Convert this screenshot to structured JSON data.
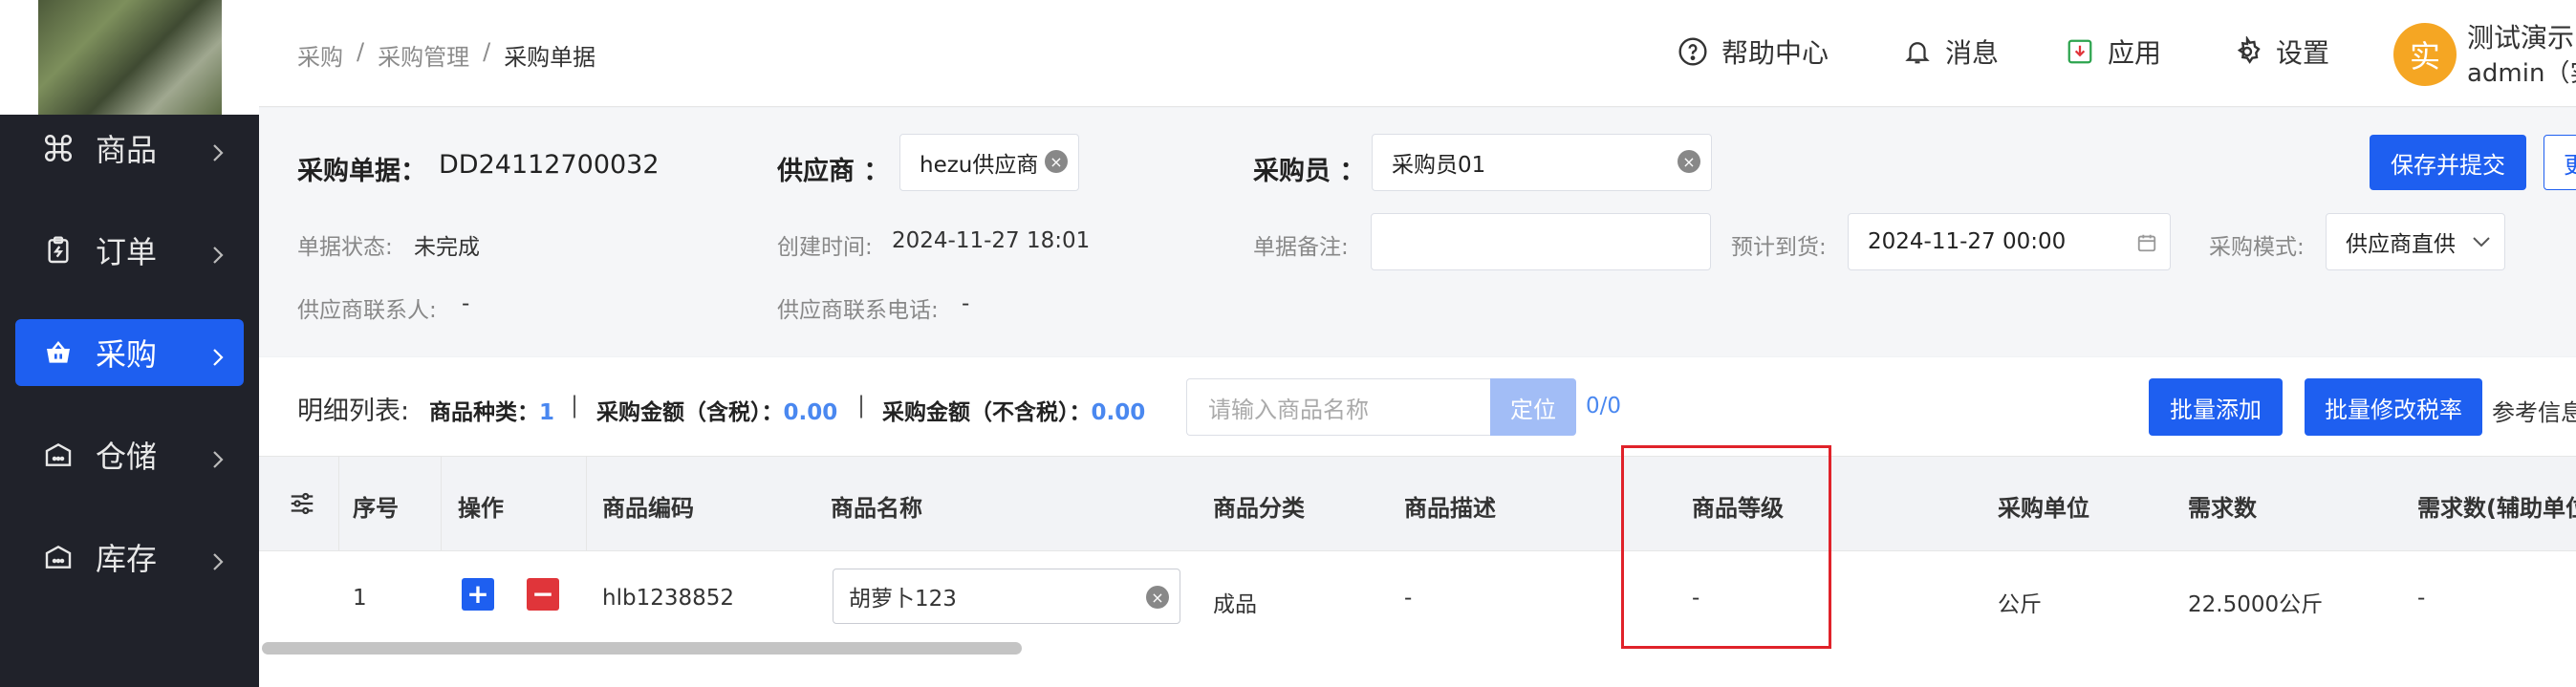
{
  "sidebar": {
    "items": [
      {
        "label": "商品",
        "icon": "command-icon"
      },
      {
        "label": "订单",
        "icon": "clipboard-icon"
      },
      {
        "label": "采购",
        "icon": "basket-icon",
        "active": true
      },
      {
        "label": "仓储",
        "icon": "warehouse-icon"
      },
      {
        "label": "库存",
        "icon": "warehouse-icon"
      }
    ]
  },
  "header": {
    "breadcrumb": [
      "采购",
      "/",
      "采购管理",
      "/",
      "采购单据"
    ],
    "help": "帮助中心",
    "messages": "消息",
    "apps": "应用",
    "settings": "设置",
    "avatar_char": "实",
    "user_name": "测试演示",
    "user_role": "admin（实"
  },
  "form": {
    "order_label": "采购单据：",
    "order_no": "DD24112700032",
    "supplier_label": "供应商 ：",
    "supplier_value": "hezu供应商",
    "buyer_label": "采购员 ：",
    "buyer_value": "采购员01",
    "save_submit": "保存并提交",
    "more_btn": "更",
    "status_label": "单据状态:",
    "status_value": "未完成",
    "created_label": "创建时间:",
    "created_value": "2024-11-27 18:01",
    "remark_label": "单据备注:",
    "remark_value": "",
    "eta_label": "预计到货:",
    "eta_value": "2024-11-27 00:00",
    "mode_label": "采购模式:",
    "mode_value": "供应商直供",
    "contact_label": "供应商联系人:",
    "contact_value": "-",
    "phone_label": "供应商联系电话:",
    "phone_value": "-"
  },
  "detail": {
    "title": "明细列表:",
    "kinds_label": "商品种类：",
    "kinds_value": "1",
    "amount_tax_label": "采购金额（含税）：",
    "amount_tax_value": "0.00",
    "amount_notax_label": "采购金额（不含税）：",
    "amount_notax_value": "0.00",
    "search_placeholder": "请输入商品名称",
    "locate_btn": "定位",
    "count": "0/0",
    "batch_add": "批量添加",
    "batch_tax": "批量修改税率",
    "ref_info": "参考信息"
  },
  "table": {
    "headers": [
      "序号",
      "操作",
      "商品编码",
      "商品名称",
      "商品分类",
      "商品描述",
      "商品等级",
      "采购单位",
      "需求数",
      "需求数(辅助单位"
    ],
    "row": {
      "index": "1",
      "plus": "+",
      "minus": "−",
      "code": "hlb1238852",
      "name": "胡萝卜123",
      "category": "成品",
      "desc": "-",
      "grade": "-",
      "unit": "公斤",
      "qty": "22.5000公斤",
      "qty_aux": "-"
    }
  },
  "colors": {
    "primary": "#1e5ff0",
    "sidebar_bg": "#20222a",
    "danger": "#e0353a",
    "highlight": "#e0222a"
  }
}
